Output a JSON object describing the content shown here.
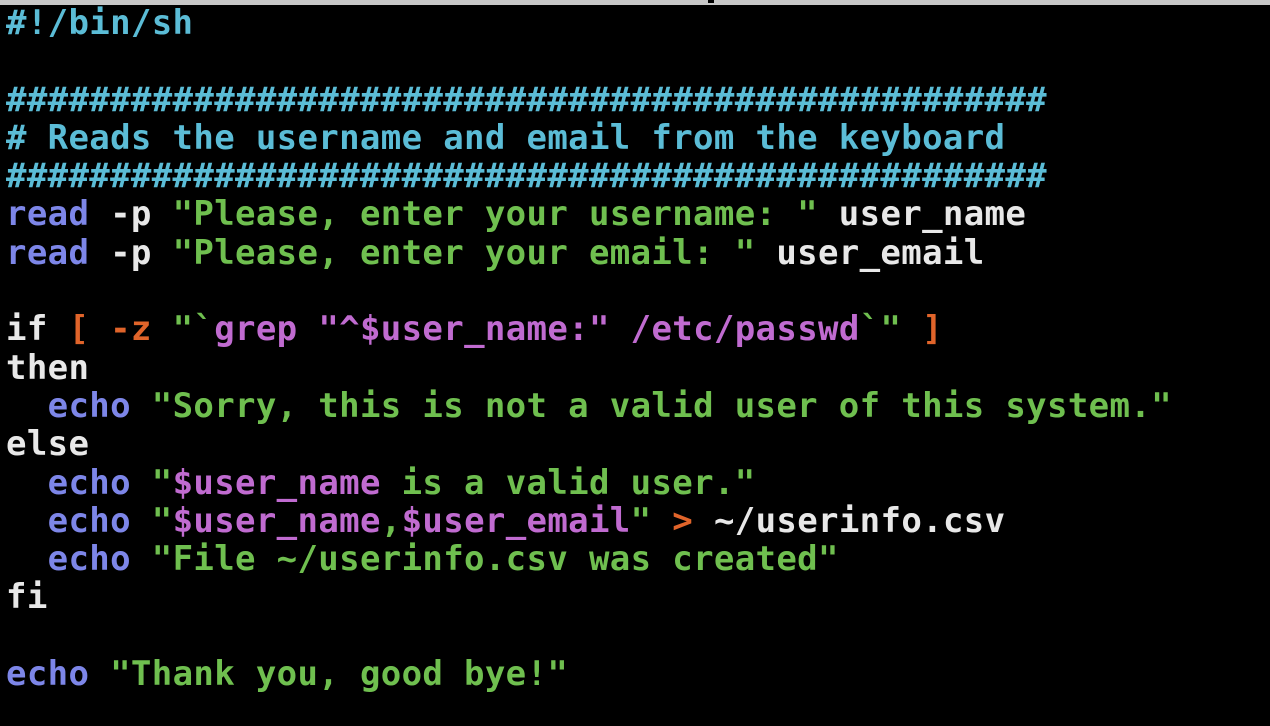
{
  "lines": [
    [
      {
        "t": "#!/bin/sh",
        "k": "comment"
      }
    ],
    [],
    [
      {
        "t": "##################################################",
        "k": "comment"
      }
    ],
    [
      {
        "t": "# Reads the username and email from the keyboard",
        "k": "comment"
      }
    ],
    [
      {
        "t": "##################################################",
        "k": "comment"
      }
    ],
    [
      {
        "t": "read",
        "k": "kw"
      },
      {
        "t": " -p ",
        "k": "plain"
      },
      {
        "t": "\"Please, enter your username: \"",
        "k": "str"
      },
      {
        "t": " user_name",
        "k": "plain"
      }
    ],
    [
      {
        "t": "read",
        "k": "kw"
      },
      {
        "t": " -p ",
        "k": "plain"
      },
      {
        "t": "\"Please, enter your email: \"",
        "k": "str"
      },
      {
        "t": " user_email",
        "k": "plain"
      }
    ],
    [],
    [
      {
        "t": "if ",
        "k": "plain"
      },
      {
        "t": "[ -z ",
        "k": "op"
      },
      {
        "t": "\"`",
        "k": "str"
      },
      {
        "t": "grep ",
        "k": "var"
      },
      {
        "t": "\"^$user_name:\"",
        "k": "var"
      },
      {
        "t": " /etc/passwd",
        "k": "var"
      },
      {
        "t": "`\"",
        "k": "str"
      },
      {
        "t": " ]",
        "k": "op"
      }
    ],
    [
      {
        "t": "then",
        "k": "plain"
      }
    ],
    [
      {
        "t": "  ",
        "k": "plain"
      },
      {
        "t": "echo",
        "k": "kw"
      },
      {
        "t": " ",
        "k": "plain"
      },
      {
        "t": "\"Sorry, this is not a valid user of this system.\"",
        "k": "str"
      }
    ],
    [
      {
        "t": "else",
        "k": "plain"
      }
    ],
    [
      {
        "t": "  ",
        "k": "plain"
      },
      {
        "t": "echo",
        "k": "kw"
      },
      {
        "t": " ",
        "k": "plain"
      },
      {
        "t": "\"",
        "k": "str"
      },
      {
        "t": "$user_name",
        "k": "var"
      },
      {
        "t": " is a valid user.\"",
        "k": "str"
      }
    ],
    [
      {
        "t": "  ",
        "k": "plain"
      },
      {
        "t": "echo",
        "k": "kw"
      },
      {
        "t": " ",
        "k": "plain"
      },
      {
        "t": "\"",
        "k": "str"
      },
      {
        "t": "$user_name",
        "k": "var"
      },
      {
        "t": ",",
        "k": "str"
      },
      {
        "t": "$user_email",
        "k": "var"
      },
      {
        "t": "\"",
        "k": "str"
      },
      {
        "t": " > ",
        "k": "op"
      },
      {
        "t": "~/userinfo.csv",
        "k": "plain"
      }
    ],
    [
      {
        "t": "  ",
        "k": "plain"
      },
      {
        "t": "echo",
        "k": "kw"
      },
      {
        "t": " ",
        "k": "plain"
      },
      {
        "t": "\"File ~/userinfo.csv was created\"",
        "k": "str"
      }
    ],
    [
      {
        "t": "fi",
        "k": "plain"
      }
    ],
    [],
    [
      {
        "t": "echo",
        "k": "kw"
      },
      {
        "t": " ",
        "k": "plain"
      },
      {
        "t": "\"Thank you, good bye!\"",
        "k": "str"
      }
    ]
  ],
  "colors": {
    "background": "#000000",
    "comment": "#5bbcd6",
    "keyword": "#7d86e8",
    "plain": "#e8e8e8",
    "string": "#6fbf4f",
    "variable": "#c06bd0",
    "operator": "#e0642a"
  }
}
